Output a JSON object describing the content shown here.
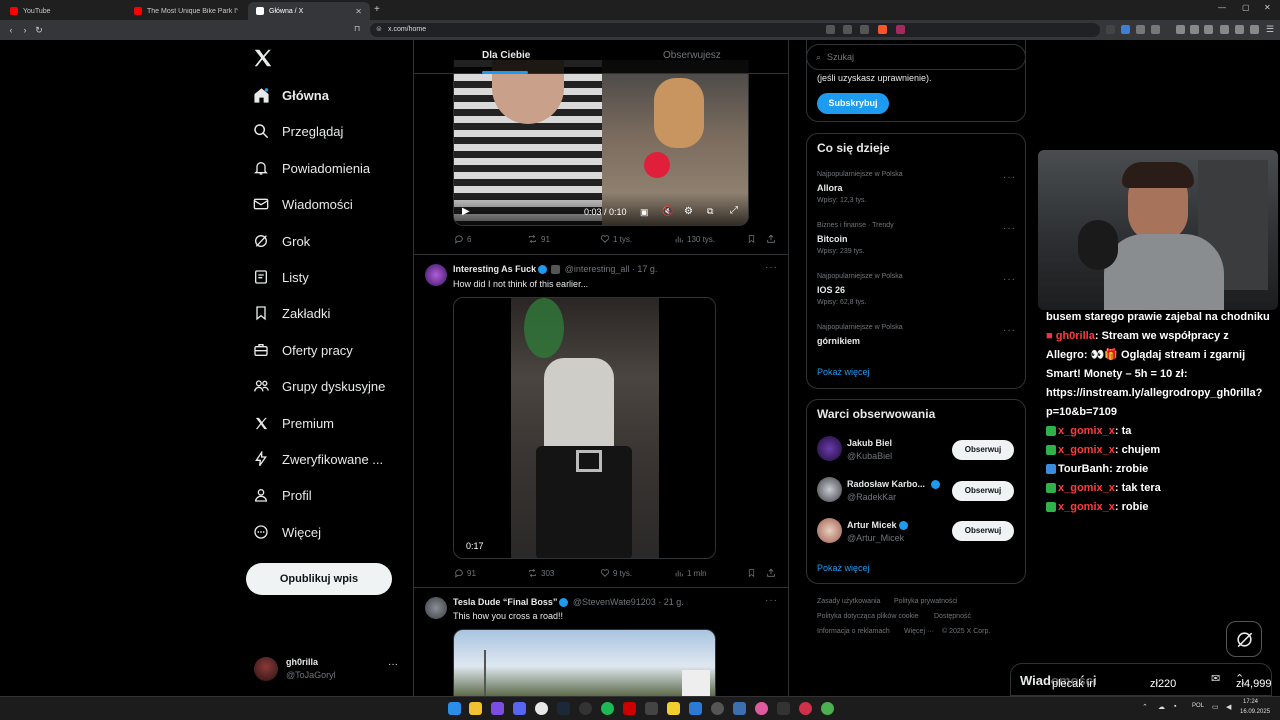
{
  "browser": {
    "tabs": [
      {
        "title": "YouTube",
        "color": "#ff0000"
      },
      {
        "title": "The Most Unique Bike Park I've Ever",
        "color": "#ff0000"
      },
      {
        "title": "Główna / X",
        "color": "#ffffff"
      }
    ],
    "url": "x.com/home"
  },
  "nav": {
    "items": [
      {
        "label": "Główna",
        "icon": "home-icon"
      },
      {
        "label": "Przeglądaj",
        "icon": "search-icon"
      },
      {
        "label": "Powiadomienia",
        "icon": "bell-icon"
      },
      {
        "label": "Wiadomości",
        "icon": "mail-icon"
      },
      {
        "label": "Grok",
        "icon": "grok-icon"
      },
      {
        "label": "Listy",
        "icon": "list-icon"
      },
      {
        "label": "Zakładki",
        "icon": "bookmark-icon"
      },
      {
        "label": "Oferty pracy",
        "icon": "briefcase-icon"
      },
      {
        "label": "Grupy dyskusyjne",
        "icon": "people-icon"
      },
      {
        "label": "Premium",
        "icon": "x-logo-icon"
      },
      {
        "label": "Zweryfikowane ...",
        "icon": "lightning-icon"
      },
      {
        "label": "Profil",
        "icon": "person-icon"
      },
      {
        "label": "Więcej",
        "icon": "more-circle-icon"
      }
    ],
    "post_button": "Opublikuj wpis",
    "account": {
      "name": "gh0rilla",
      "handle": "@ToJaGoryl"
    }
  },
  "timeline": {
    "tabs": {
      "for_you": "Dla Ciebie",
      "following": "Obserwujesz"
    },
    "tweet1": {
      "video_time": "0:03 / 0:10",
      "replies": "6",
      "reposts": "91",
      "likes": "1 tys.",
      "views": "130 tys."
    },
    "tweet2": {
      "name": "Interesting As Fuck",
      "handle": "@interesting_all · 17 g.",
      "text": "How did I not think of this earlier...",
      "video_duration": "0:17",
      "replies": "91",
      "reposts": "303",
      "likes": "9 tys.",
      "views": "1 mln"
    },
    "tweet3": {
      "name": "Tesla Dude “Final Boss”",
      "handle": "@StevenWate91203 · 21 g.",
      "text": "This how you cross a road!!"
    }
  },
  "sidebar": {
    "search_placeholder": "Szukaj",
    "premium_text": "(jeśli uzyskasz uprawnienie).",
    "subscribe": "Subskrybuj",
    "trends_title": "Co się dzieje",
    "trends": [
      {
        "category": "Najpopularniejsze w Polska",
        "name": "Allora",
        "count": "Wpisy: 12,3 tys."
      },
      {
        "category": "Biznes i finanse · Trendy",
        "name": "Bitcoin",
        "count": "Wpisy: 239 tys."
      },
      {
        "category": "Najpopularniejsze w Polska",
        "name": "IOS 26",
        "count": "Wpisy: 62,8 tys."
      },
      {
        "category": "Najpopularniejsze w Polska",
        "name": "górnikiem",
        "count": ""
      }
    ],
    "show_more": "Pokaż więcej",
    "who_title": "Warci obserwowania",
    "who": [
      {
        "name": "Jakub Biel",
        "handle": "@KubaBiel",
        "verified": false
      },
      {
        "name": "Radosław Karbo...",
        "handle": "@RadekKar",
        "verified": true
      },
      {
        "name": "Artur Micek",
        "handle": "@Artur_Micek",
        "verified": true
      }
    ],
    "follow": "Obserwuj",
    "footer": [
      "Zasady użytkowania",
      "Polityka prywatności",
      "Polityka dotycząca plików cookie",
      "Dostępność",
      "Informacja o reklamach",
      "Więcej ···",
      "© 2025 X Corp."
    ]
  },
  "stream": {
    "chat": [
      {
        "user": "",
        "text": "busem starego prawie zajebal na chodniku"
      },
      {
        "user": "gh0rilla",
        "text": ": Stream we współpracy z Allegro: 👀🎁 Oglądaj stream i zgarnij Smart! Monety – 5h = 10 zł: https://instream.ly/allegrodropy_gh0rilla?p=10&b=7109"
      },
      {
        "user": "x_gomix_x",
        "text": ": ta"
      },
      {
        "user": "x_gomix_x",
        "text": ": chujem"
      },
      {
        "user": "TourBanh",
        "text": ": zrobie"
      },
      {
        "user": "x_gomix_x",
        "text": ": tak tera"
      },
      {
        "user": "x_gomix_x",
        "text": ": robie"
      }
    ],
    "messages": "Wiadomości",
    "donation_name": "plecak irl",
    "donation_amount1": "zł220",
    "donation_amount2": "zł4,999"
  },
  "taskbar": {
    "lang": "POL",
    "time": "17:24",
    "date": "16.09.2025"
  },
  "colors": {
    "accent": "#1d9bf0",
    "background": "#000000",
    "border": "#2f3336"
  }
}
